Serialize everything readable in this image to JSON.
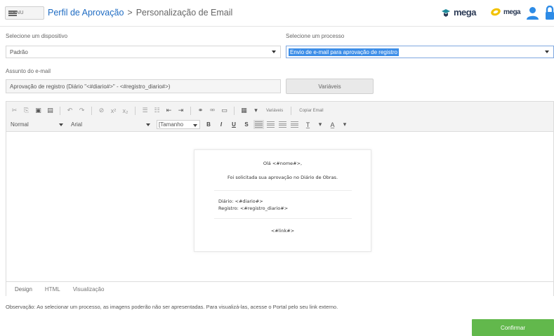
{
  "header": {
    "menu_label": "MENU",
    "breadcrumb": {
      "link": "Perfil de Aprovação",
      "separator": ">",
      "current": "Personalização de Email"
    },
    "brand_primary": "mega",
    "brand_secondary": "mega",
    "brand_colors": {
      "primary": "#2b3a55",
      "accent": "#e8a90c",
      "user": "#2d8be6"
    }
  },
  "form": {
    "device_label": "Selecione um dispositivo",
    "device_value": "Padrão",
    "process_label": "Selecione um processo",
    "process_value": "Envio de e-mail para aprovação de registro",
    "subject_label": "Assunto do e-mail",
    "subject_value": "Aprovação de registro (Diário \"<#diario#>\" - <#registro_diario#>)",
    "variables_button": "Variáveis"
  },
  "editor": {
    "toolbar": {
      "variables_link": "Variáveis",
      "copy_email_link": "Copiar Email",
      "style_select": "Normal",
      "font_select": "Arial",
      "size_select": "[Tamanho",
      "bold": "B",
      "italic": "I",
      "underline": "U",
      "strike": "S"
    },
    "content": {
      "greeting": "Olá <#nome#>,",
      "message": "Foi solicitada sua aprovação no Diário de Obras.",
      "diario_line": "Diário: <#diario#>",
      "registro_line": "Registro: <#registro_diario#>",
      "link_line": "<#link#>"
    },
    "tabs": [
      "Design",
      "HTML",
      "Visualização"
    ],
    "active_tab": "Design"
  },
  "footer": {
    "note": "Observação: Ao selecionar um processo, as imagens poderão não ser apresentadas. Para visualizá-las, acesse o Portal pelo seu link externo.",
    "confirm_button": "Confirmar",
    "confirm_color": "#62b84c"
  }
}
